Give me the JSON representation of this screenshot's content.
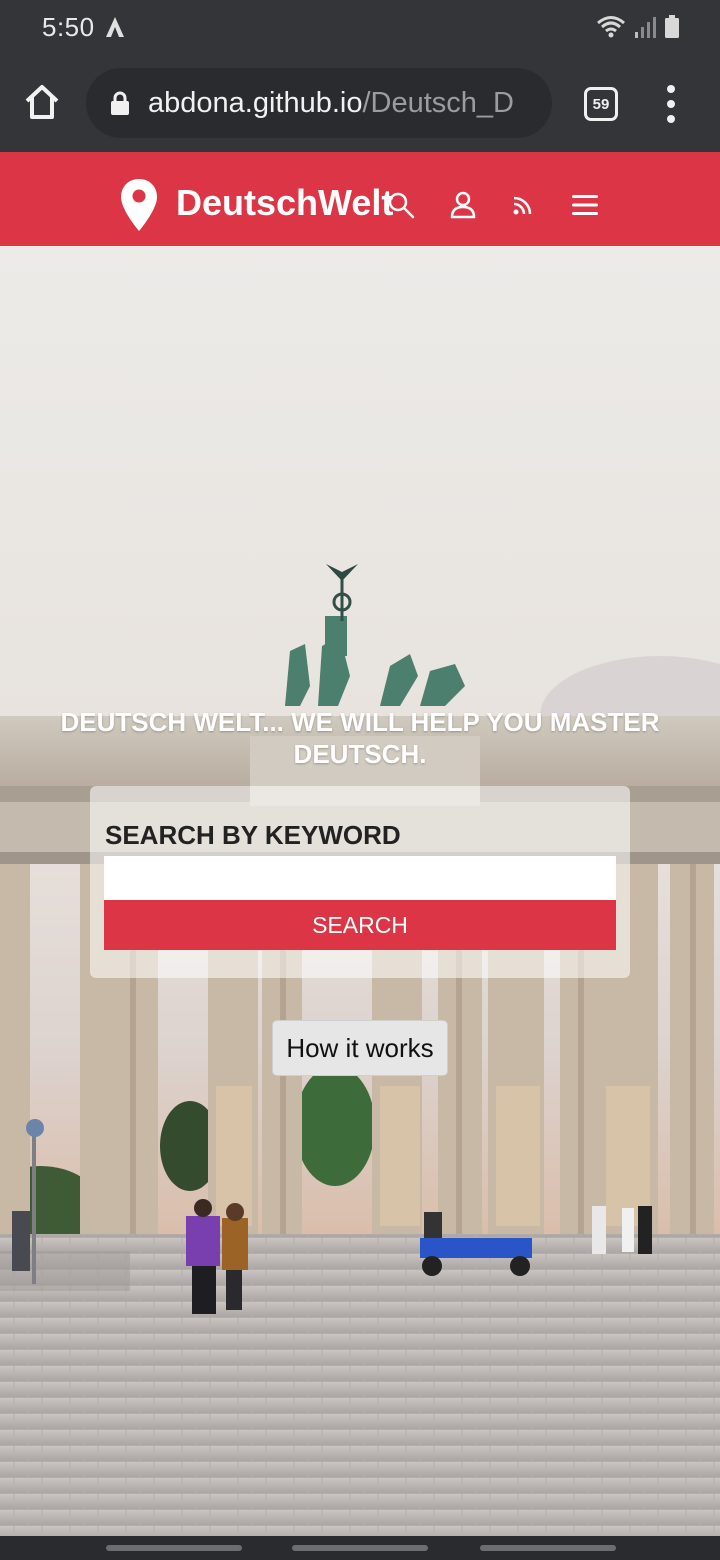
{
  "status_bar": {
    "time": "5:50",
    "icons": [
      "font-a-icon",
      "wifi-icon",
      "signal-icon",
      "battery-icon"
    ]
  },
  "browser": {
    "url_host": "abdona.github.io",
    "url_path": "/Deutsch_D",
    "tab_count": "59",
    "icons": [
      "home-icon",
      "lock-icon",
      "overflow-menu-icon"
    ]
  },
  "site_header": {
    "brand": "DeutschWelt",
    "background_color": "#dc3545",
    "icons": [
      "location-pin-icon",
      "search-icon",
      "user-icon",
      "rss-icon",
      "hamburger-menu-icon"
    ]
  },
  "hero": {
    "title": "Deutsch Welt... We will help you master Deutsch.",
    "search_label": "SEARCH BY KEYWORD",
    "search_value": "",
    "search_button": "SEARCH",
    "how_it_works": "How it works"
  },
  "colors": {
    "accent": "#dc3545",
    "chrome": "#333539"
  }
}
